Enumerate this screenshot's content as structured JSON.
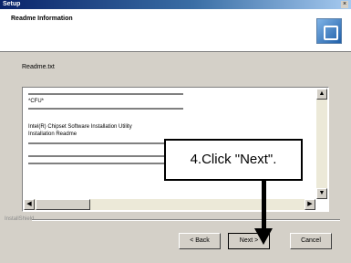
{
  "window": {
    "title": "Setup",
    "close_glyph": "×"
  },
  "header": {
    "title": "Readme Information",
    "icon": "setup-icon"
  },
  "readme": {
    "label": "Readme.txt",
    "lines": [
      "*CFU*",
      "Intel(R) Chipset Software Installation Utility",
      "Installation Readme"
    ]
  },
  "scroll": {
    "up": "▲",
    "down": "▼",
    "left": "◀",
    "right": "▶"
  },
  "separator_label": "InstallShield",
  "buttons": {
    "back": "< Back",
    "next": "Next >",
    "cancel": "Cancel"
  },
  "callout": {
    "text": "4.Click \"Next\"."
  }
}
